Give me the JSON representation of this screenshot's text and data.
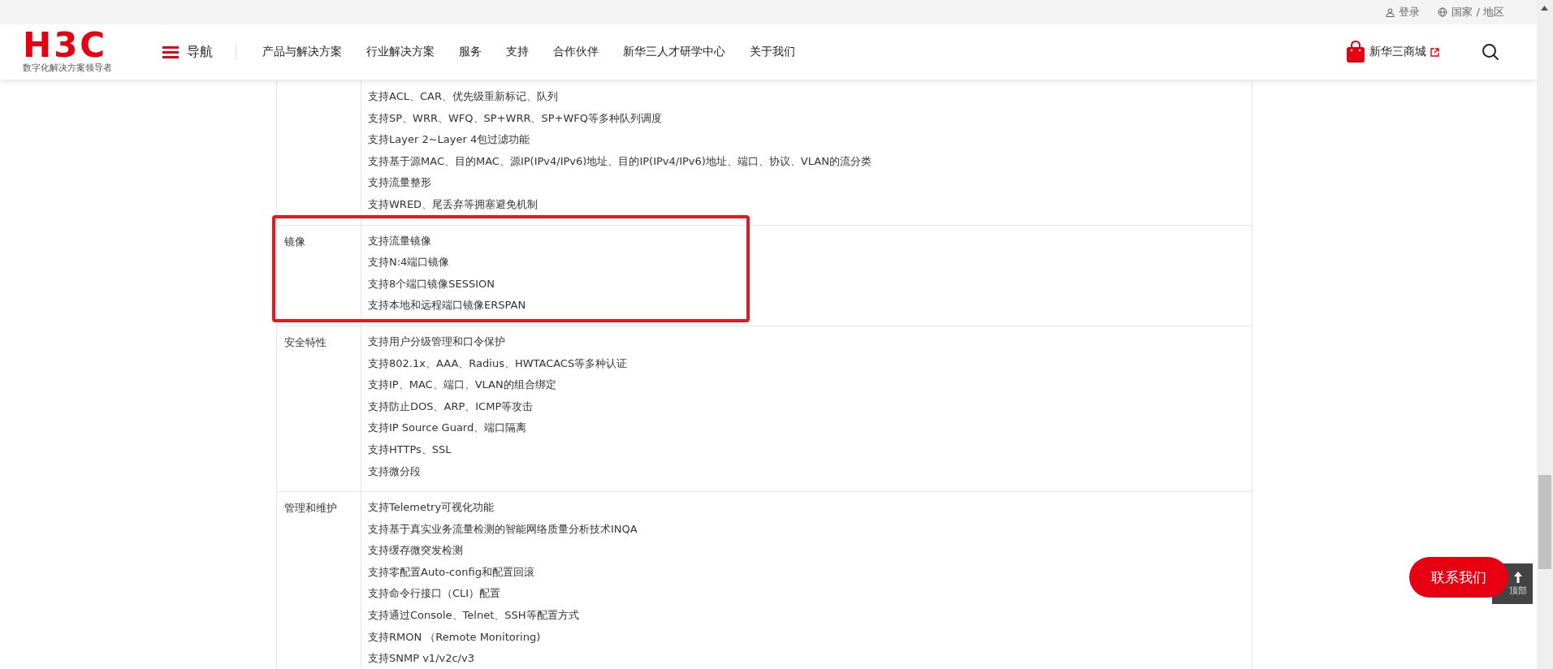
{
  "top_bar": {
    "login": "登录",
    "region": "国家 / 地区"
  },
  "header": {
    "logo": "H3C",
    "slogan": "数字化解决方案领导者",
    "nav_toggle": "导航",
    "nav_items": [
      "产品与解决方案",
      "行业解决方案",
      "服务",
      "支持",
      "合作伙伴",
      "新华三人才研学中心",
      "关于我们"
    ],
    "store": "新华三商城"
  },
  "spec_table": {
    "rows": [
      {
        "highlighted": false,
        "lines": [
          "支持ACL、CAR、优先级重新标记、队列",
          "支持SP、WRR、WFQ、SP+WRR、SP+WFQ等多种队列调度",
          "支持Layer 2~Layer 4包过滤功能",
          "支持基于源MAC、目的MAC、源IP(IPv4/IPv6)地址、目的IP(IPv4/IPv6)地址、端口、协议、VLAN的流分类",
          "支持流量整形",
          "支持WRED、尾丢弃等拥塞避免机制"
        ]
      },
      {
        "label": "镜像",
        "highlighted": true,
        "lines": [
          "支持流量镜像",
          "支持N:4端口镜像",
          "支持8个端口镜像SESSION",
          "支持本地和远程端口镜像ERSPAN"
        ]
      },
      {
        "label": "安全特性",
        "highlighted": false,
        "lines": [
          "支持用户分级管理和口令保护",
          "支持802.1x、AAA、Radius、HWTACACS等多种认证",
          "支持IP、MAC、端口、VLAN的组合绑定",
          "支持防止DOS、ARP、ICMP等攻击",
          "支持IP Source Guard、端口隔离",
          "支持HTTPs、SSL",
          "支持微分段"
        ]
      },
      {
        "label": "管理和维护",
        "highlighted": false,
        "lines": [
          "支持Telemetry可视化功能",
          "支持基于真实业务流量检测的智能网络质量分析技术INQA",
          "支持缓存微突发检测",
          "支持零配置Auto-config和配置回滚",
          "支持命令行接口（CLI）配置",
          "支持通过Console、Telnet、SSH等配置方式",
          "支持RMON （Remote Monitoring)",
          "支持SNMP v1/v2c/v3"
        ]
      }
    ]
  },
  "contact_button": "联系我们",
  "back_to_top": "顶部"
}
